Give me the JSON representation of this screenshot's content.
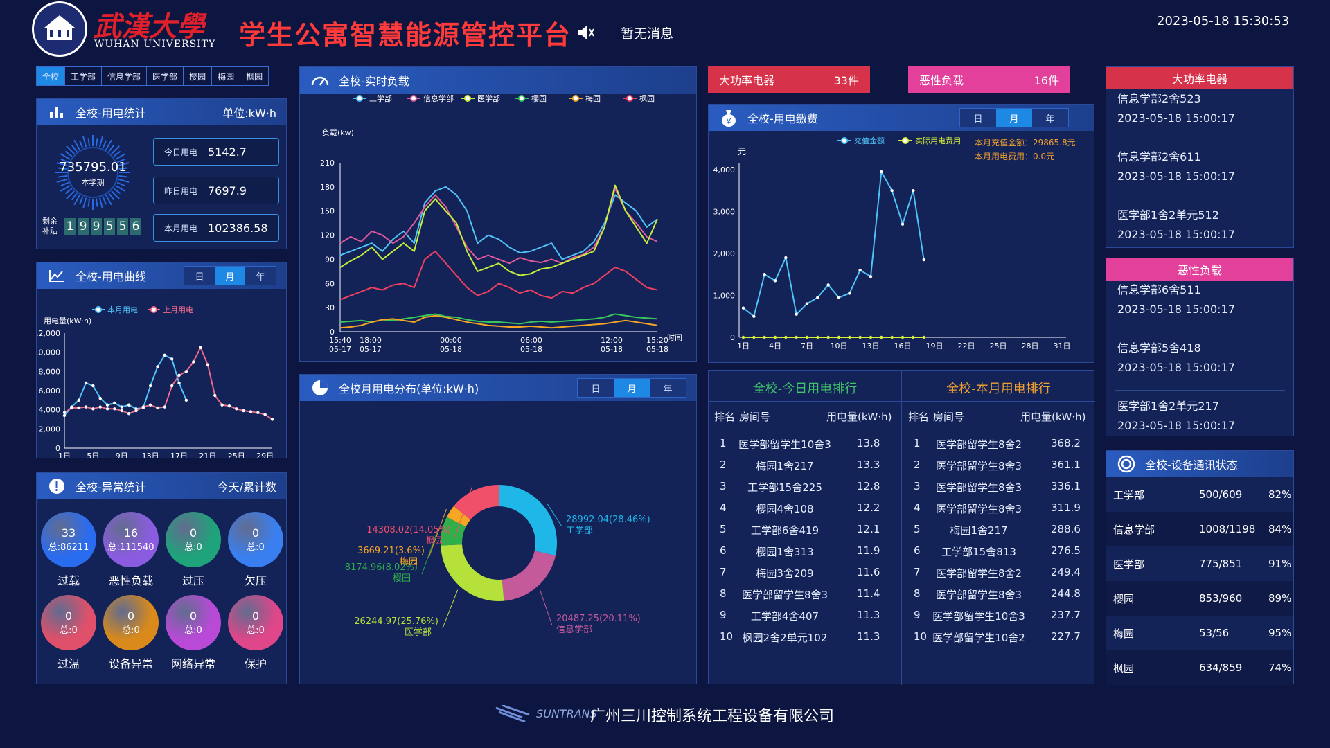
{
  "header": {
    "school_cn": "武漢大學",
    "school_en": "WUHAN UNIVERSITY",
    "title": "学生公寓智慧能源管控平台",
    "message": "暂无消息",
    "datetime": "2023-05-18 15:30:53"
  },
  "campus_tabs": [
    "全校",
    "工学部",
    "信息学部",
    "医学部",
    "樱园",
    "梅园",
    "枫园"
  ],
  "stats": {
    "title": "全校-用电统计",
    "unit": "单位:kW·h",
    "period_value": "735795.01",
    "period_label": "本学期",
    "remaining_label_1": "剩余",
    "remaining_label_2": "补贴",
    "remaining_digits": [
      "1",
      "9",
      "9",
      "5",
      "5",
      "6"
    ],
    "today_label": "今日用电",
    "today_value": "5142.7",
    "yesterday_label": "昨日用电",
    "yesterday_value": "7697.9",
    "month_label": "本月用电",
    "month_value": "102386.58"
  },
  "curve": {
    "title": "全校-用电曲线",
    "segments": [
      "日",
      "月",
      "年"
    ],
    "active": "月",
    "legend": [
      "本月用电",
      "上月用电"
    ],
    "ylabel": "用电量(kW·h)"
  },
  "anomaly": {
    "title": "全校-异常统计",
    "subtitle": "今天/累计数",
    "items": [
      {
        "value": "33",
        "total": "总:86211",
        "label": "过载",
        "color": "#2a6cf0"
      },
      {
        "value": "16",
        "total": "总:111540",
        "label": "恶性负载",
        "color": "#8b5ce0"
      },
      {
        "value": "0",
        "total": "总:0",
        "label": "过压",
        "color": "#1fa37a"
      },
      {
        "value": "0",
        "total": "总:0",
        "label": "欠压",
        "color": "#3a7ff0"
      },
      {
        "value": "0",
        "total": "总:0",
        "label": "过温",
        "color": "#e0506a"
      },
      {
        "value": "0",
        "total": "总:0",
        "label": "设备异常",
        "color": "#d98a1a"
      },
      {
        "value": "0",
        "total": "总:0",
        "label": "网络异常",
        "color": "#b94ad8"
      },
      {
        "value": "0",
        "total": "总:0",
        "label": "保护",
        "color": "#e0468a"
      }
    ]
  },
  "realtime": {
    "title": "全校-实时负载",
    "ylabel": "负载(kw)",
    "xlabel": "时间",
    "legend": [
      "工学部",
      "信息学部",
      "医学部",
      "樱园",
      "梅园",
      "枫园"
    ],
    "colors": [
      "#4fc3f7",
      "#e05a9a",
      "#c6ef3a",
      "#37c85a",
      "#f5a623",
      "#f04060"
    ]
  },
  "dist": {
    "title": "全校月用电分布(单位:kW·h)",
    "segments": [
      "日",
      "月",
      "年"
    ],
    "active": "月"
  },
  "alarm": {
    "high_label": "大功率电器",
    "high_count": "33件",
    "bad_label": "恶性负载",
    "bad_count": "16件"
  },
  "fee": {
    "title": "全校-用电缴费",
    "segments": [
      "日",
      "月",
      "年"
    ],
    "active": "月",
    "unit": "元",
    "legend": [
      "充值金额",
      "实际用电费用"
    ],
    "note1": "本月充值金额：29865.8元",
    "note2": "本月用电费用：0.0元"
  },
  "rank_today": {
    "title": "全校-今日用电排行",
    "cols": [
      "排名",
      "房间号",
      "用电量(kW·h)"
    ],
    "rows": [
      [
        "1",
        "医学部留学生10舍3",
        "13.8"
      ],
      [
        "2",
        "梅园1舍217",
        "13.3"
      ],
      [
        "3",
        "工学部15舍225",
        "12.8"
      ],
      [
        "4",
        "樱园4舍108",
        "12.2"
      ],
      [
        "5",
        "工学部6舍419",
        "12.1"
      ],
      [
        "6",
        "樱园1舍313",
        "11.9"
      ],
      [
        "7",
        "梅园3舍209",
        "11.6"
      ],
      [
        "8",
        "医学部留学生8舍3",
        "11.4"
      ],
      [
        "9",
        "工学部4舍407",
        "11.3"
      ],
      [
        "10",
        "枫园2舍2单元102",
        "11.3"
      ]
    ]
  },
  "rank_month": {
    "title": "全校-本月用电排行",
    "cols": [
      "排名",
      "房间号",
      "用电量(kW·h)"
    ],
    "rows": [
      [
        "1",
        "医学部留学生8舍2",
        "368.2"
      ],
      [
        "2",
        "医学部留学生8舍3",
        "361.1"
      ],
      [
        "3",
        "医学部留学生8舍3",
        "336.1"
      ],
      [
        "4",
        "医学部留学生8舍3",
        "311.9"
      ],
      [
        "5",
        "梅园1舍217",
        "288.6"
      ],
      [
        "6",
        "工学部15舍813",
        "276.5"
      ],
      [
        "7",
        "医学部留学生8舍2",
        "249.4"
      ],
      [
        "8",
        "医学部留学生8舍3",
        "244.8"
      ],
      [
        "9",
        "医学部留学生10舍3",
        "237.7"
      ],
      [
        "10",
        "医学部留学生10舍2",
        "227.7"
      ]
    ]
  },
  "high_power": {
    "title": "大功率电器",
    "items": [
      [
        "信息学部2舍523",
        "2023-05-18 15:00:17"
      ],
      [
        "信息学部2舍611",
        "2023-05-18 15:00:17"
      ],
      [
        "医学部1舍2单元512",
        "2023-05-18 15:00:17"
      ]
    ]
  },
  "bad_load": {
    "title": "恶性负载",
    "items": [
      [
        "信息学部6舍511",
        "2023-05-18 15:00:17"
      ],
      [
        "信息学部5舍418",
        "2023-05-18 15:00:17"
      ],
      [
        "医学部1舍2单元217",
        "2023-05-18 15:00:17"
      ]
    ]
  },
  "devices": {
    "title": "全校-设备通讯状态",
    "rows": [
      [
        "工学部",
        "500/609",
        "82%"
      ],
      [
        "信息学部",
        "1008/1198",
        "84%"
      ],
      [
        "医学部",
        "775/851",
        "91%"
      ],
      [
        "樱园",
        "853/960",
        "89%"
      ],
      [
        "梅园",
        "53/56",
        "95%"
      ],
      [
        "枫园",
        "634/859",
        "74%"
      ]
    ]
  },
  "footer": {
    "brand": "SUNTRANS",
    "company": "广州三川控制系统工程设备有限公司"
  },
  "chart_data": [
    {
      "type": "line",
      "name": "全校-用电曲线",
      "x": [
        "1日",
        "2日",
        "3日",
        "4日",
        "5日",
        "6日",
        "7日",
        "8日",
        "9日",
        "10日",
        "11日",
        "12日",
        "13日",
        "14日",
        "15日",
        "16日",
        "17日",
        "18日",
        "19日",
        "20日",
        "21日",
        "22日",
        "23日",
        "24日",
        "25日",
        "26日",
        "27日",
        "28日",
        "29日",
        "30日"
      ],
      "xticks": [
        "1日",
        "5日",
        "9日",
        "13日",
        "17日",
        "21日",
        "25日",
        "29日"
      ],
      "ylim": [
        0,
        12000
      ],
      "yticks": [
        0,
        2000,
        4000,
        6000,
        8000,
        10000,
        12000
      ],
      "series": [
        {
          "name": "本月用电",
          "values": [
            3400,
            4300,
            5000,
            6800,
            6500,
            5200,
            4500,
            4700,
            4300,
            4500,
            4100,
            4200,
            6500,
            8500,
            9700,
            9300,
            6800,
            5000
          ]
        },
        {
          "name": "上月用电",
          "values": [
            3700,
            4200,
            4200,
            4300,
            4100,
            4300,
            4100,
            4100,
            3900,
            3600,
            3900,
            4300,
            4500,
            4200,
            4300,
            6500,
            7600,
            8000,
            9000,
            10500,
            8700,
            5500,
            4500,
            4400,
            4100,
            3900,
            3800,
            3700,
            3500,
            3000
          ]
        }
      ]
    },
    {
      "type": "line",
      "name": "全校-实时负载",
      "ylim": [
        0,
        210
      ],
      "yticks": [
        0,
        30,
        60,
        90,
        120,
        150,
        180,
        210
      ],
      "xticks": [
        "15:40 05-17",
        "18:00 05-17",
        "00:00 05-18",
        "06:00 05-18",
        "12:00 05-18",
        "15:20 05-18"
      ],
      "series": [
        {
          "name": "工学部",
          "values": [
            95,
            100,
            105,
            110,
            100,
            115,
            125,
            110,
            160,
            175,
            180,
            170,
            150,
            110,
            120,
            115,
            105,
            98,
            100,
            105,
            110,
            90,
            95,
            100,
            112,
            135,
            170,
            160,
            150,
            130,
            140
          ]
        },
        {
          "name": "信息学部",
          "values": [
            110,
            118,
            112,
            125,
            120,
            110,
            118,
            135,
            155,
            170,
            155,
            130,
            105,
            90,
            95,
            90,
            85,
            92,
            88,
            86,
            90,
            85,
            92,
            96,
            105,
            130,
            178,
            150,
            135,
            118,
            112
          ]
        },
        {
          "name": "医学部",
          "values": [
            80,
            88,
            95,
            105,
            90,
            100,
            110,
            100,
            150,
            165,
            150,
            135,
            100,
            75,
            80,
            85,
            75,
            70,
            72,
            78,
            80,
            85,
            90,
            95,
            100,
            130,
            182,
            150,
            130,
            110,
            140
          ]
        },
        {
          "name": "樱园",
          "values": [
            12,
            13,
            14,
            12,
            15,
            14,
            16,
            18,
            20,
            22,
            19,
            18,
            15,
            13,
            12,
            12,
            11,
            10,
            12,
            13,
            12,
            13,
            14,
            15,
            16,
            18,
            22,
            20,
            18,
            17,
            16
          ]
        },
        {
          "name": "梅园",
          "values": [
            5,
            6,
            8,
            12,
            15,
            16,
            14,
            12,
            18,
            20,
            18,
            15,
            12,
            10,
            8,
            7,
            6,
            6,
            7,
            6,
            5,
            6,
            7,
            8,
            9,
            10,
            12,
            14,
            12,
            10,
            8
          ]
        },
        {
          "name": "枫园",
          "values": [
            40,
            45,
            50,
            55,
            52,
            58,
            60,
            55,
            90,
            100,
            85,
            70,
            55,
            45,
            50,
            60,
            55,
            48,
            52,
            45,
            42,
            50,
            48,
            55,
            60,
            70,
            80,
            75,
            65,
            55,
            52
          ]
        }
      ]
    },
    {
      "type": "pie",
      "name": "全校月用电分布",
      "series": [
        {
          "name": "工学部",
          "value": 28992.04,
          "label": "28992.04(28.46%)",
          "color": "#1fb6e8"
        },
        {
          "name": "信息学部",
          "value": 20487.25,
          "label": "20487.25(20.11%)",
          "color": "#c45a9a"
        },
        {
          "name": "医学部",
          "value": 26244.97,
          "label": "26244.97(25.76%)",
          "color": "#b6e03a"
        },
        {
          "name": "樱园",
          "value": 8174.96,
          "label": "8174.96(8.02%)",
          "color": "#2fae4a"
        },
        {
          "name": "梅园",
          "value": 3669.21,
          "label": "3669.21(3.6%)",
          "color": "#f5a623"
        },
        {
          "name": "枫园",
          "value": 14308.02,
          "label": "14308.02(14.05%)",
          "color": "#f0506a"
        }
      ]
    },
    {
      "type": "line",
      "name": "全校-用电缴费",
      "xticks": [
        "1日",
        "4日",
        "7日",
        "10日",
        "13日",
        "16日",
        "19日",
        "22日",
        "25日",
        "28日",
        "31日"
      ],
      "ylim": [
        0,
        4000
      ],
      "yticks": [
        0,
        1000,
        2000,
        3000,
        4000
      ],
      "series": [
        {
          "name": "充值金额",
          "values": [
            700,
            500,
            1500,
            1350,
            1900,
            550,
            800,
            950,
            1250,
            950,
            1050,
            1600,
            1450,
            3950,
            3500,
            2700,
            3500,
            1850
          ]
        },
        {
          "name": "实际用电费用",
          "values": [
            0,
            0,
            0,
            0,
            0,
            0,
            0,
            0,
            0,
            0,
            0,
            0,
            0,
            0,
            0,
            0,
            0,
            0
          ]
        }
      ]
    }
  ]
}
